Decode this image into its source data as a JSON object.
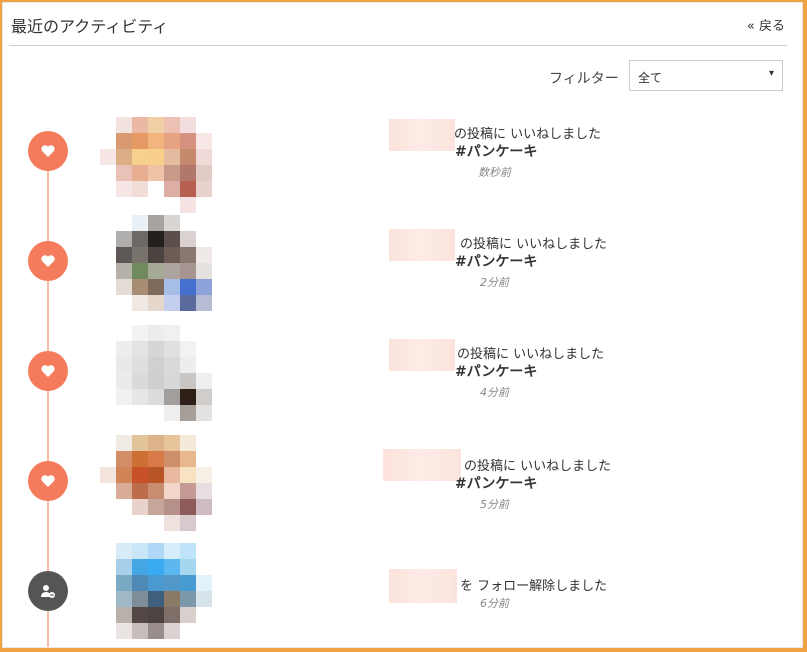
{
  "header": {
    "title": "最近のアクティビティ",
    "back_label": "« 戻る"
  },
  "filter": {
    "label": "フィルター",
    "selected": "全て"
  },
  "icons": {
    "like": "heart-icon",
    "unfollow": "user-minus-icon",
    "dropdown": "caret-down-icon"
  },
  "colors": {
    "accent": "#f47c5d",
    "timeline": "#f5b9a4",
    "unfollow_icon": "#555555",
    "frame": "#f0a243"
  },
  "activities": [
    {
      "action": "の投稿に いいねしました",
      "tag": "#パンケーキ",
      "time": "数秒前",
      "type": "like"
    },
    {
      "action": "の投稿に いいねしました",
      "tag": "#パンケーキ",
      "time": "2分前",
      "type": "like"
    },
    {
      "action": "の投稿に いいねしました",
      "tag": "#パンケーキ",
      "time": "4分前",
      "type": "like"
    },
    {
      "action": "の投稿に いいねしました",
      "tag": "#パンケーキ",
      "time": "5分前",
      "type": "like"
    },
    {
      "action": "を フォロー解除しました",
      "tag": "",
      "time": "6分前",
      "type": "unfollow"
    }
  ]
}
